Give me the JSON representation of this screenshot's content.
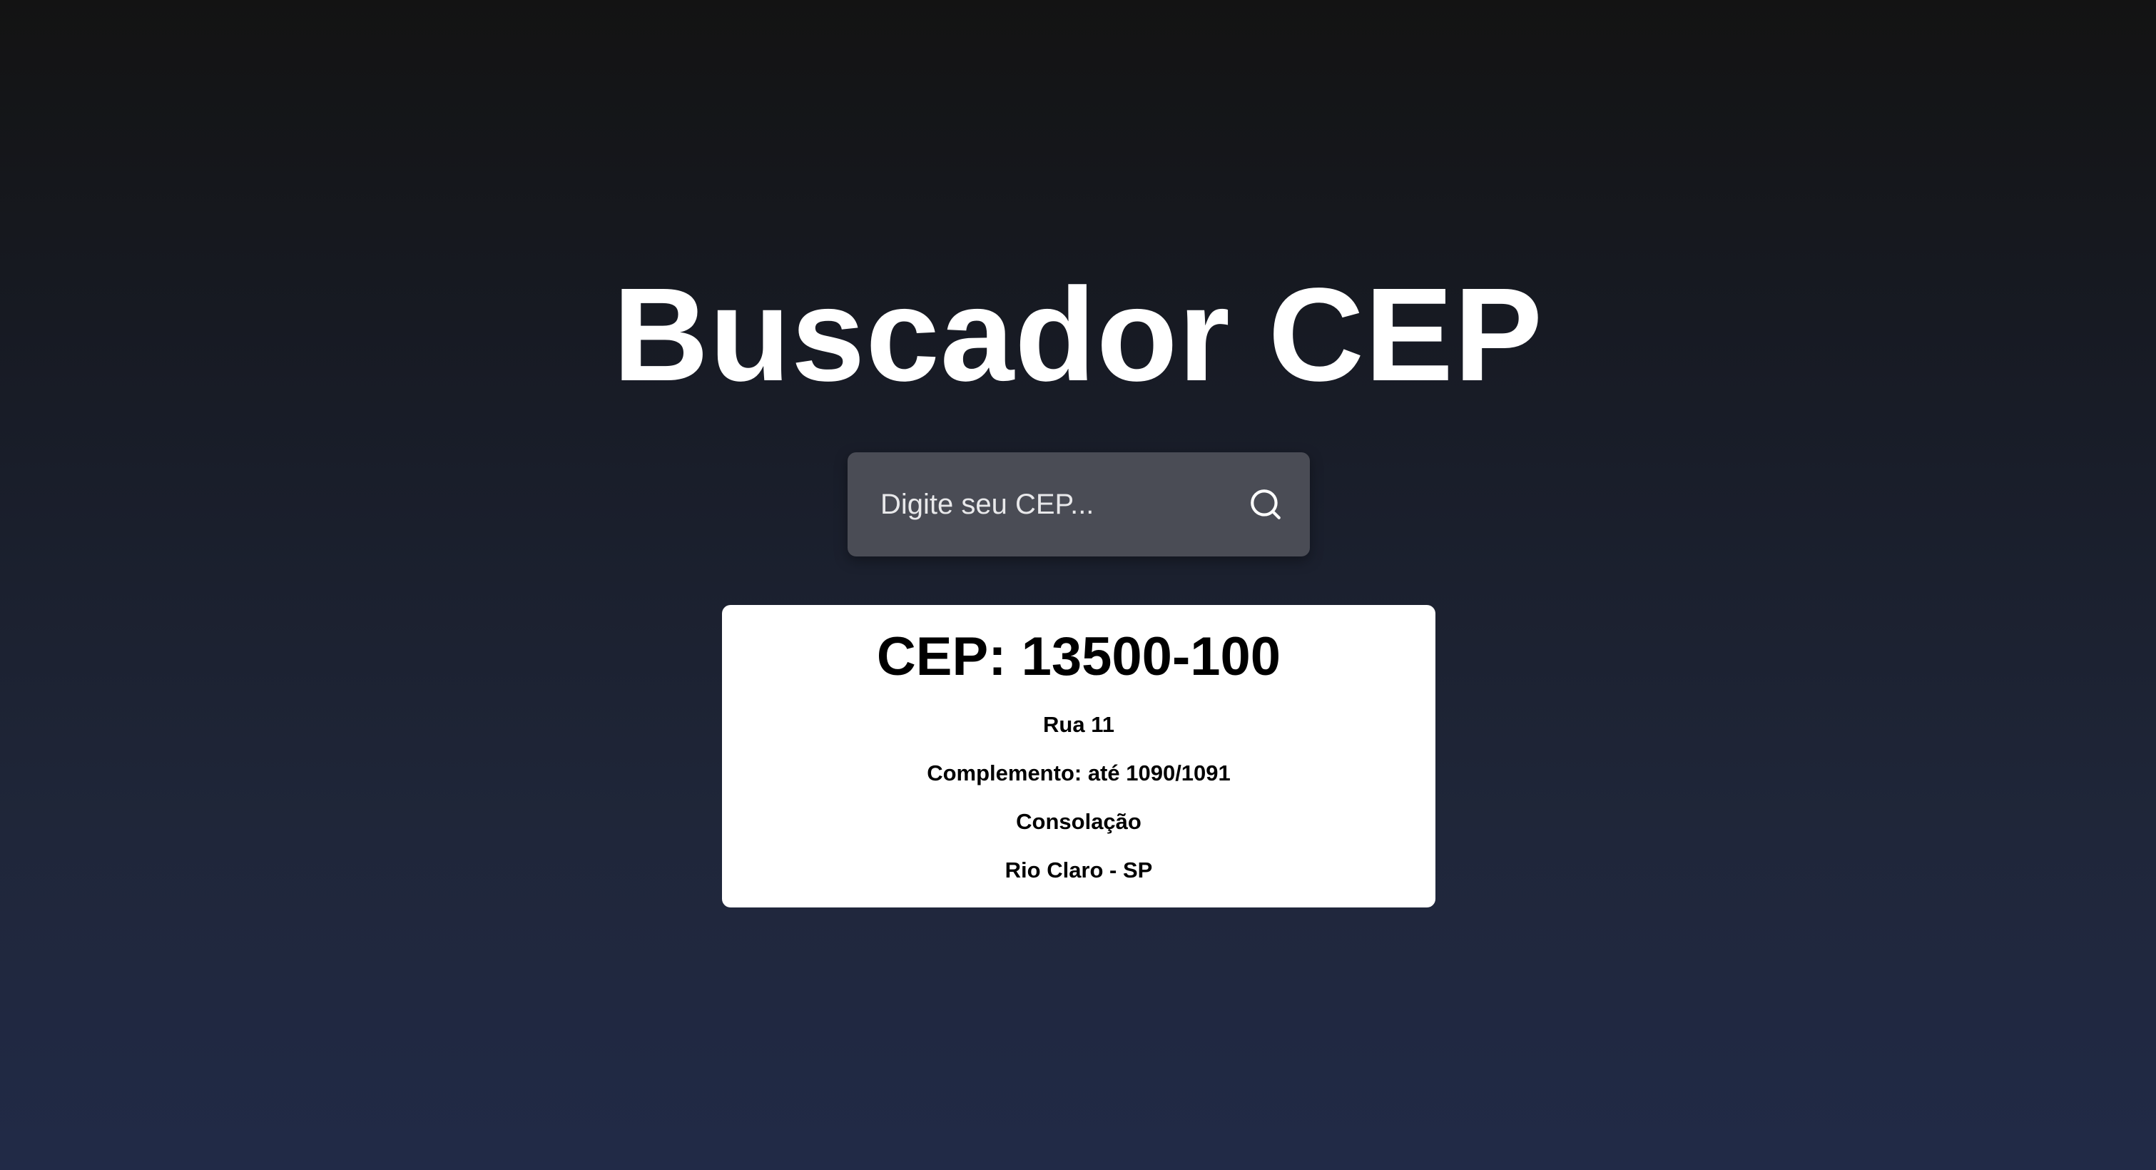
{
  "page": {
    "title": "Buscador CEP"
  },
  "search": {
    "placeholder": "Digite seu CEP...",
    "value": "",
    "icon": "search-icon"
  },
  "result": {
    "cep_label": "CEP: 13500-100",
    "street": "Rua 11",
    "complement": "Complemento: até 1090/1091",
    "neighborhood": "Consolação",
    "city_state": "Rio Claro - SP"
  },
  "colors": {
    "background_top": "#131313",
    "background_bottom": "#212a47",
    "search_box": "#4a4c55",
    "card": "#ffffff",
    "title_text": "#ffffff"
  }
}
